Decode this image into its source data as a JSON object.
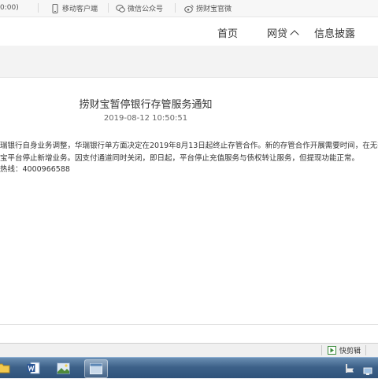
{
  "topbar": {
    "fragment": "0:00)",
    "links": [
      {
        "label": "移动客户端",
        "icon": "mobile-icon"
      },
      {
        "label": "微信公众号",
        "icon": "wechat-icon"
      },
      {
        "label": "捞财宝官微",
        "icon": "weibo-icon"
      }
    ]
  },
  "nav": {
    "items": [
      {
        "label": "首页"
      },
      {
        "label": "网贷",
        "icon": "chevron-up-icon"
      },
      {
        "label": "信息披露"
      }
    ]
  },
  "article": {
    "title": "捞财宝暂停银行存管服务通知",
    "date": "2019-08-12 10:50:51",
    "lines": [
      "瑞银行自身业务调整，华瑞银行单方面决定在2019年8月13日起终止存管合作。新的存管合作开展需要时间，在无存",
      "宝平台停止新增业务。因支付通道同时关闭，即日起，平台停止充值服务与债权转让服务，但提现功能正常。",
      "热线：4000966588"
    ]
  },
  "statusbar": {
    "clipboard_label": "快剪辑"
  },
  "colors": {
    "taskbar": "#3d6189",
    "page_bg": "#ffffff",
    "band": "#f3f3f3"
  }
}
